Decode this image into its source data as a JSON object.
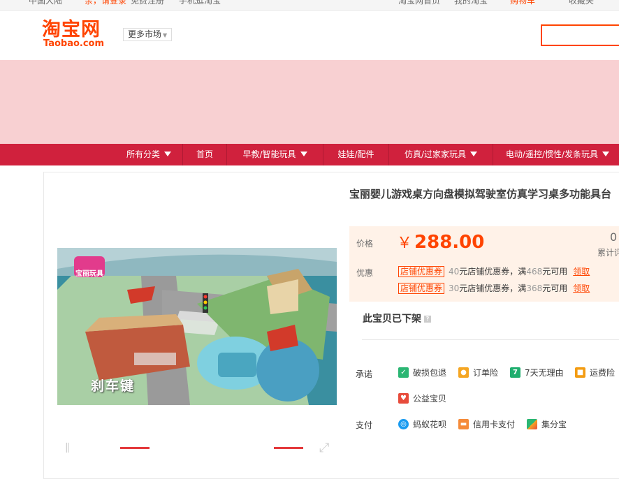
{
  "topnav": {
    "items": [
      "中国大陆",
      "亲，请登录",
      "免费注册",
      "手机逛淘宝",
      "淘宝网首页",
      "我的淘宝",
      "购物车",
      "收藏夹"
    ]
  },
  "header": {
    "logo_cn": "淘宝网",
    "logo_en": "Taobao.com",
    "market_label": "更多市场"
  },
  "catbar": {
    "items": [
      "所有分类",
      "首页",
      "早教/智能玩具",
      "娃娃/配件",
      "仿真/过家家玩具",
      "电动/遥控/惯性/发条玩具"
    ]
  },
  "gallery": {
    "brand_badge": "宝丽玩具",
    "image_caption": "刹车键"
  },
  "product": {
    "title": "宝丽婴儿游戏桌方向盘模拟驾驶室仿真学习桌多功能具台",
    "price_label": "价格",
    "currency": "￥",
    "price": "288.00",
    "sales_count": "0",
    "sales_label": "累计评",
    "promo_label": "优惠",
    "coupons": [
      {
        "tag": "店铺优惠券",
        "amount": "40",
        "text_mid": "元店铺优惠券，满",
        "threshold": "468",
        "text_end": "元可用",
        "link": "领取"
      },
      {
        "tag": "店铺优惠券",
        "amount": "30",
        "text_mid": "元店铺优惠券，满",
        "threshold": "368",
        "text_end": "元可用",
        "link": "领取"
      }
    ],
    "status": "此宝贝已下架",
    "promise_label": "承诺",
    "promises": [
      "破损包退",
      "订单险",
      "7天无理由",
      "运费险",
      "公益宝贝"
    ],
    "payment_label": "支付",
    "payments": [
      "蚂蚁花呗",
      "信用卡支付",
      "集分宝"
    ]
  },
  "colors": {
    "brand_orange": "#ff4400",
    "category_bar": "#d0213d",
    "banner": "#f8d0d2",
    "price_box": "#fff2e8"
  }
}
